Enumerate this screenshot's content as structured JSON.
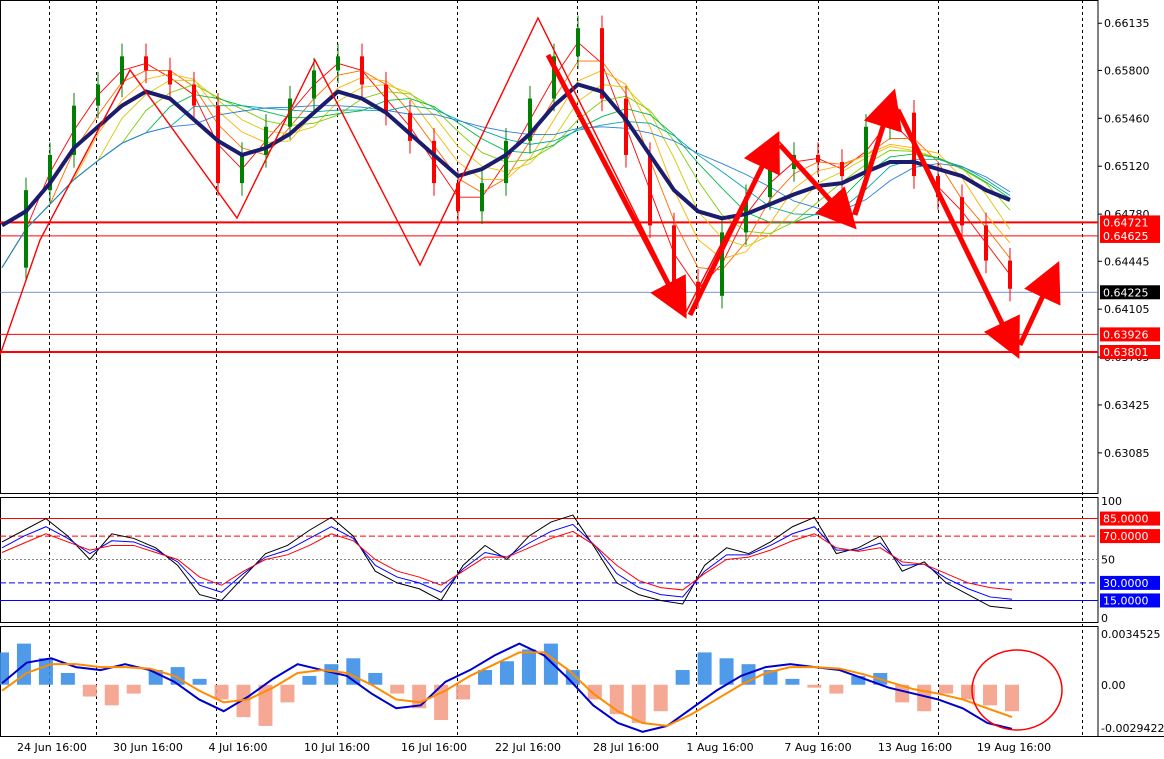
{
  "chart_data": [
    {
      "type": "line",
      "panel": "price",
      "ylim": [
        0.628,
        0.663
      ],
      "y_ticks": [
        "0.66135",
        "0.65800",
        "0.65460",
        "0.65120",
        "0.64780",
        "0.64445",
        "0.64105",
        "0.63765",
        "0.63425",
        "0.63085"
      ],
      "price_labels": [
        {
          "text": "0.64721",
          "value": 0.64721,
          "color": "#ff0000"
        },
        {
          "text": "0.64625",
          "value": 0.64625,
          "color": "#ff0000"
        },
        {
          "text": "0.64225",
          "value": 0.64225,
          "color": "#000000"
        },
        {
          "text": "0.63926",
          "value": 0.63926,
          "color": "#ff0000"
        },
        {
          "text": "0.63801",
          "value": 0.63801,
          "color": "#ff0000"
        }
      ],
      "x_ticks": [
        "24 Jun 16:00",
        "30 Jun 16:00",
        "4 Jul 16:00",
        "10 Jul 16:00",
        "16 Jul 16:00",
        "22 Jul 16:00",
        "28 Jul 16:00",
        "1 Aug 16:00",
        "7 Aug 16:00",
        "13 Aug 16:00",
        "19 Aug 16:00"
      ],
      "series": [
        {
          "values": [
            0.644,
            0.6495,
            0.652,
            0.6555,
            0.657,
            0.659,
            0.658,
            0.657,
            0.6555,
            0.65,
            0.652,
            0.654,
            0.656,
            0.658,
            0.659,
            0.657,
            0.655,
            0.653,
            0.65,
            0.648,
            0.65,
            0.653,
            0.656,
            0.659,
            0.661,
            0.656,
            0.652,
            0.647,
            0.643,
            0.642,
            0.6465,
            0.649,
            0.651,
            0.652,
            0.6515,
            0.6505,
            0.654,
            0.655,
            0.6505,
            0.649,
            0.647,
            0.6445,
            0.6425
          ],
          "color": "#ff0000"
        },
        {
          "values": [
            0.647,
            0.648,
            0.65,
            0.6525,
            0.654,
            0.6555,
            0.6565,
            0.656,
            0.6545,
            0.653,
            0.652,
            0.6525,
            0.6535,
            0.655,
            0.6565,
            0.656,
            0.655,
            0.6535,
            0.652,
            0.6505,
            0.651,
            0.652,
            0.6535,
            0.6555,
            0.657,
            0.6565,
            0.6545,
            0.652,
            0.6495,
            0.648,
            0.6475,
            0.6478,
            0.6485,
            0.6492,
            0.6498,
            0.65,
            0.6508,
            0.6515,
            0.6515,
            0.651,
            0.6505,
            0.6495,
            0.6488
          ],
          "color": "#1c1c6e"
        }
      ]
    },
    {
      "type": "line",
      "panel": "stochastic",
      "ylim": [
        0,
        100
      ],
      "y_ticks": [
        "100",
        "50",
        "0"
      ],
      "levels": [
        {
          "text": "85.0000",
          "value": 85,
          "color": "#ff0000"
        },
        {
          "text": "70.0000",
          "value": 70,
          "color": "#ff0000"
        },
        {
          "text": "30.0000",
          "value": 30,
          "color": "#0000ff"
        },
        {
          "text": "15.0000",
          "value": 15,
          "color": "#0000ff"
        }
      ],
      "series": [
        {
          "values": [
            65,
            75,
            85,
            70,
            50,
            72,
            68,
            60,
            45,
            20,
            15,
            35,
            55,
            62,
            75,
            86,
            70,
            40,
            30,
            25,
            15,
            45,
            62,
            50,
            70,
            82,
            88,
            60,
            30,
            20,
            15,
            12,
            45,
            60,
            55,
            65,
            78,
            86,
            55,
            60,
            70,
            40,
            48,
            30,
            20,
            10,
            8
          ],
          "color": "#000000"
        },
        {
          "values": [
            60,
            70,
            78,
            68,
            55,
            66,
            65,
            58,
            48,
            28,
            22,
            38,
            52,
            58,
            68,
            78,
            68,
            45,
            35,
            30,
            22,
            42,
            56,
            52,
            64,
            74,
            80,
            62,
            38,
            26,
            20,
            18,
            40,
            54,
            54,
            62,
            72,
            78,
            58,
            58,
            64,
            45,
            46,
            34,
            25,
            18,
            16
          ],
          "color": "#0000ff"
        },
        {
          "values": [
            56,
            64,
            72,
            65,
            58,
            62,
            62,
            56,
            50,
            35,
            28,
            40,
            50,
            54,
            62,
            72,
            66,
            50,
            40,
            35,
            28,
            40,
            52,
            52,
            60,
            68,
            74,
            62,
            45,
            32,
            26,
            24,
            38,
            50,
            52,
            58,
            66,
            72,
            60,
            57,
            60,
            48,
            46,
            38,
            30,
            26,
            24
          ],
          "color": "#ff0000"
        }
      ]
    },
    {
      "type": "bar",
      "panel": "macd",
      "ylim": [
        -0.0029422,
        0.0034525
      ],
      "y_ticks": [
        "0.0034525",
        "0.00",
        "-0.0029422"
      ],
      "histogram": [
        0.0022,
        0.0028,
        0.0018,
        0.0008,
        -0.0008,
        -0.0014,
        -0.0006,
        0.001,
        0.0012,
        0.0004,
        -0.001,
        -0.0022,
        -0.0028,
        -0.0012,
        0.0006,
        0.0014,
        0.0018,
        0.0008,
        -0.0006,
        -0.0016,
        -0.0024,
        -0.001,
        0.001,
        0.0016,
        0.0024,
        0.0028,
        0.001,
        -0.001,
        -0.002,
        -0.0026,
        -0.0018,
        0.001,
        0.0022,
        0.0018,
        0.0014,
        0.001,
        0.0004,
        -0.0002,
        -0.0006,
        0.0006,
        0.0008,
        -0.0012,
        -0.0018,
        -0.0006,
        -0.001,
        -0.0014,
        -0.0018
      ],
      "series": [
        {
          "values": [
            0.0001,
            0.0015,
            0.0018,
            0.0012,
            0.001,
            0.0014,
            0.001,
            0.0002,
            -0.001,
            -0.0018,
            -0.0008,
            0.0004,
            0.0014,
            0.001,
            0.0006,
            -0.0006,
            -0.0016,
            -0.0014,
            0.0002,
            0.001,
            0.002,
            0.0028,
            0.002,
            0.0004,
            -0.0014,
            -0.0026,
            -0.0032,
            -0.0028,
            -0.0016,
            -0.0004,
            0.0006,
            0.0012,
            0.0014,
            0.0012,
            0.001,
            0.0004,
            -0.0002,
            -0.0006,
            -0.001,
            -0.0016,
            -0.0026,
            -0.003
          ],
          "color": "#0000cc"
        },
        {
          "values": [
            -0.0004,
            0.0008,
            0.0014,
            0.0014,
            0.0012,
            0.0012,
            0.0011,
            0.0006,
            -0.0004,
            -0.0012,
            -0.001,
            -0.0002,
            0.0008,
            0.001,
            0.0008,
            0.0,
            -0.001,
            -0.0012,
            -0.0004,
            0.0006,
            0.0014,
            0.0022,
            0.0022,
            0.001,
            -0.0006,
            -0.0018,
            -0.0026,
            -0.0028,
            -0.002,
            -0.001,
            0.0,
            0.0008,
            0.0012,
            0.0012,
            0.0011,
            0.0007,
            0.0002,
            -0.0003,
            -0.0006,
            -0.001,
            -0.0016,
            -0.0022
          ],
          "color": "#ff8c00"
        }
      ]
    }
  ],
  "annotations": {
    "arrows_color": "#ff0000"
  }
}
